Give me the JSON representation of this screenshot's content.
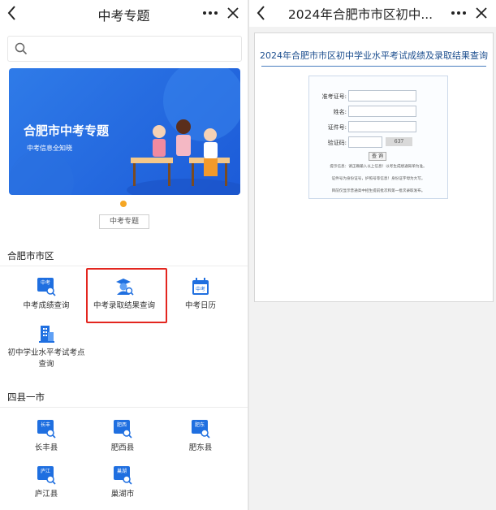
{
  "left": {
    "nav": {
      "title": "中考专题"
    },
    "search": {
      "placeholder": ""
    },
    "banner": {
      "title": "合肥市中考专题",
      "subtitle": "中考信息全知晓"
    },
    "tag": "中考专题",
    "section1": {
      "title": "合肥市市区",
      "items": [
        {
          "label": "中考成绩查询"
        },
        {
          "label": "中考录取结果查询"
        },
        {
          "label": "中考日历"
        },
        {
          "label": "初中学业水平考试考点查询"
        }
      ]
    },
    "section2": {
      "title": "四县一市",
      "items": [
        {
          "label": "长丰县",
          "icon_text": "长丰"
        },
        {
          "label": "肥西县",
          "icon_text": "肥西"
        },
        {
          "label": "肥东县",
          "icon_text": "肥东"
        },
        {
          "label": "庐江县",
          "icon_text": "庐江"
        },
        {
          "label": "巢湖市",
          "icon_text": "巢湖"
        }
      ]
    },
    "icons": {
      "zk_text": "中考"
    }
  },
  "right": {
    "nav": {
      "title": "2024年合肥市市区初中..."
    },
    "card": {
      "title": "2024年合肥市市区初中学业水平考试成绩及录取结果查询",
      "fields": [
        {
          "label": "准考证号:"
        },
        {
          "label": "姓名:"
        },
        {
          "label": "证件号:"
        },
        {
          "label": "验证码:"
        }
      ],
      "captcha": "637",
      "query_button": "查 询",
      "notes": [
        "提示信息：请正确输入以上信息！以考生成绩通知单为准。",
        "证件号为身份证号，护照号等信息！身份证字母为大写。",
        "目前仅显示普通高中招生提前批次和第一批次录取发布。"
      ]
    }
  },
  "colors": {
    "accent": "#1f6fe0",
    "highlight": "#e3261f",
    "banner": "#2f7be8"
  }
}
